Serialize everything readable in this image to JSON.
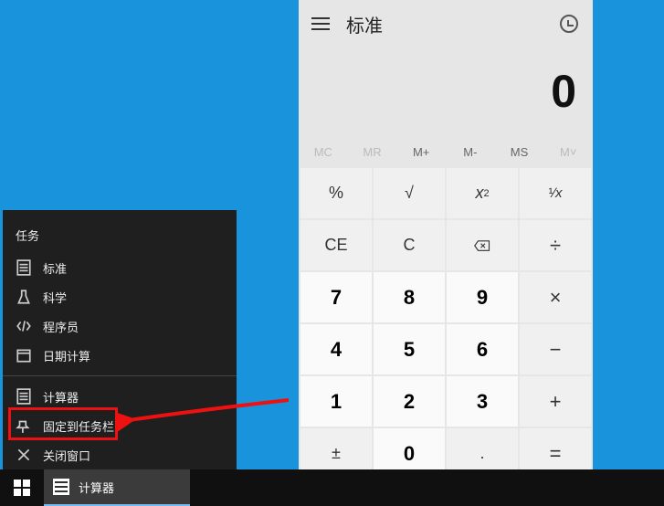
{
  "calculator": {
    "mode_label": "标准",
    "display_value": "0",
    "memory_buttons": [
      {
        "label": "MC",
        "disabled": true
      },
      {
        "label": "MR",
        "disabled": true
      },
      {
        "label": "M+",
        "disabled": false
      },
      {
        "label": "M-",
        "disabled": false
      },
      {
        "label": "MS",
        "disabled": false
      },
      {
        "label": "M˅",
        "disabled": true
      }
    ],
    "keys": {
      "percent": "%",
      "sqrt": "√",
      "square": "x²",
      "reciprocal": "¹∕ₓ",
      "ce": "CE",
      "c": "C",
      "backspace": "⌫",
      "divide": "÷",
      "k7": "7",
      "k8": "8",
      "k9": "9",
      "multiply": "×",
      "k4": "4",
      "k5": "5",
      "k6": "6",
      "minus": "−",
      "k1": "1",
      "k2": "2",
      "k3": "3",
      "plus": "+",
      "negate": "±",
      "k0": "0",
      "decimal": ".",
      "equals": "="
    }
  },
  "jumplist": {
    "tasks_title": "任务",
    "tasks": [
      {
        "label": "标准",
        "icon": "calc"
      },
      {
        "label": "科学",
        "icon": "flask"
      },
      {
        "label": "程序员",
        "icon": "code"
      },
      {
        "label": "日期计算",
        "icon": "calendar"
      }
    ],
    "app_name": "计算器",
    "pin_label": "固定到任务栏",
    "close_label": "关闭窗口"
  },
  "taskbar": {
    "app_label": "计算器"
  }
}
